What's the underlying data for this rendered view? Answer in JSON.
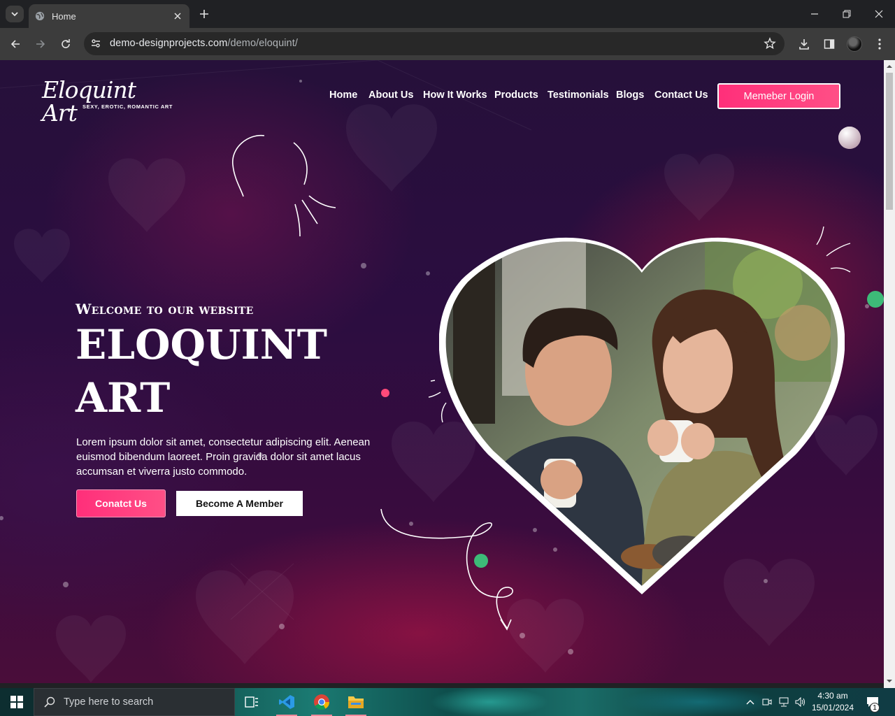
{
  "browser": {
    "tab_title": "Home",
    "url_host": "demo-designprojects.com",
    "url_path": "/demo/eloquint/"
  },
  "site": {
    "logo_text": "Eloquint Art",
    "logo_tagline": "SEXY, EROTIC, ROMANTIC ART",
    "nav": [
      "Home",
      "About Us",
      "How It Works",
      "Products",
      "Testimonials",
      "Blogs",
      "Contact Us"
    ],
    "login_label": "Memeber Login"
  },
  "hero": {
    "welcome": "Welcome to our website",
    "title_line1": "ELOQUINT",
    "title_line2": "ART",
    "lead": "Lorem ipsum dolor sit amet, consectetur adipiscing elit. Aenean euismod bibendum laoreet. Proin gravida dolor sit amet lacus accumsan et viverra justo commodo.",
    "contact_label": "Conatct Us",
    "member_label": "Become A Member"
  },
  "taskbar": {
    "search_placeholder": "Type here to search",
    "time": "4:30 am",
    "date": "15/01/2024",
    "notification_count": "1"
  },
  "colors": {
    "accent_pink": "#ff2f7a",
    "accent_green": "#3dbb78",
    "bg_purple": "#2b0d40"
  }
}
